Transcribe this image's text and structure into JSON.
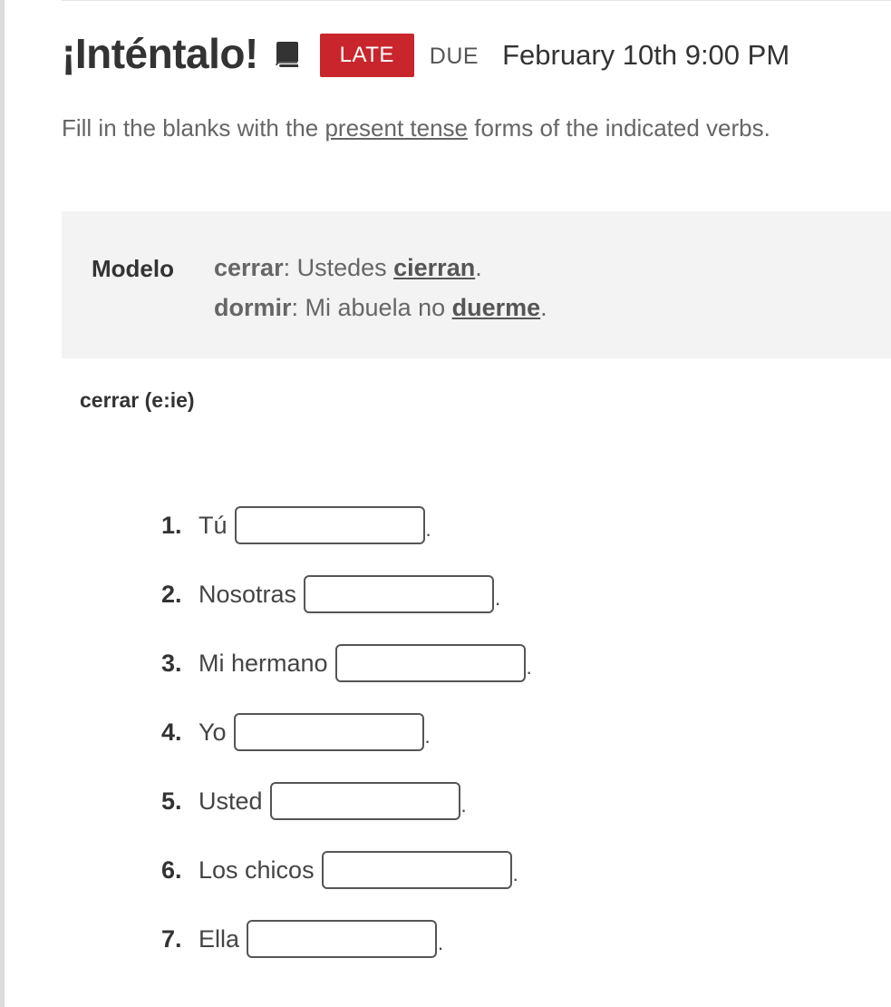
{
  "header": {
    "title": "¡Inténtalo!",
    "book_icon": "book-icon",
    "status_badge": "LATE",
    "due_label": "DUE",
    "due_date": "February 10th 9:00 PM"
  },
  "instructions": {
    "before": "Fill in the blanks with the ",
    "link": "present tense",
    "after": " forms of the indicated verbs."
  },
  "model": {
    "label": "Modelo",
    "examples": [
      {
        "verb": "cerrar",
        "sentence_before": ": Ustedes ",
        "answer": "cierran",
        "end": "."
      },
      {
        "verb": "dormir",
        "sentence_before": ": Mi abuela no ",
        "answer": "duerme",
        "end": "."
      }
    ]
  },
  "section": {
    "heading": "cerrar (e:ie)"
  },
  "items": [
    {
      "number": "1.",
      "subject": "Tú",
      "value": "",
      "end": "."
    },
    {
      "number": "2.",
      "subject": "Nosotras",
      "value": "",
      "end": "."
    },
    {
      "number": "3.",
      "subject": "Mi hermano",
      "value": "",
      "end": "."
    },
    {
      "number": "4.",
      "subject": "Yo",
      "value": "",
      "end": "."
    },
    {
      "number": "5.",
      "subject": "Usted",
      "value": "",
      "end": "."
    },
    {
      "number": "6.",
      "subject": "Los chicos",
      "value": "",
      "end": "."
    },
    {
      "number": "7.",
      "subject": "Ella",
      "value": "",
      "end": "."
    }
  ]
}
